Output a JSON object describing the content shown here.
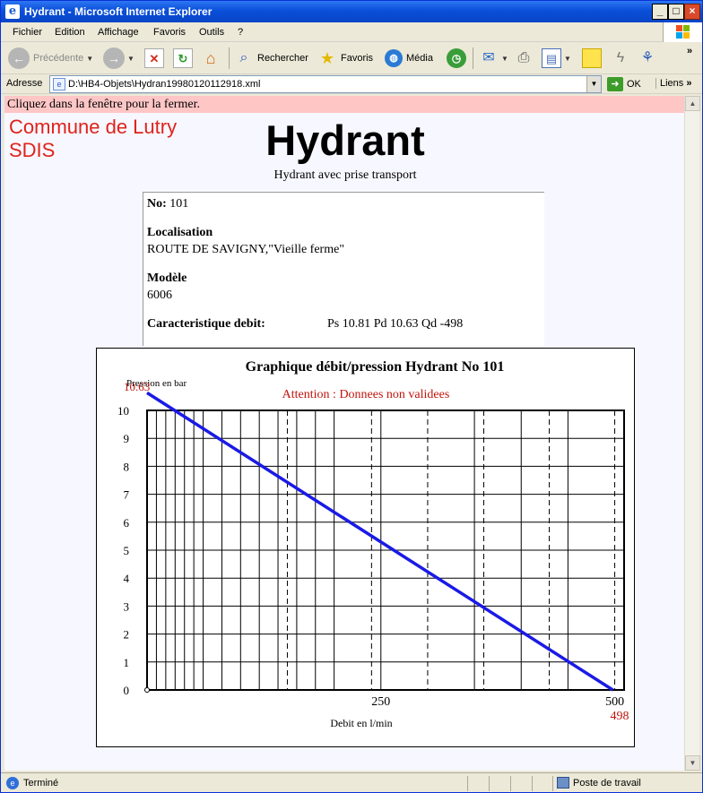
{
  "window": {
    "title": "Hydrant - Microsoft Internet Explorer",
    "controls": [
      "_",
      "□",
      "×"
    ]
  },
  "menu": {
    "items": [
      {
        "label": "Fichier"
      },
      {
        "label": "Edition"
      },
      {
        "label": "Affichage"
      },
      {
        "label": "Favoris"
      },
      {
        "label": "Outils"
      },
      {
        "label": "?"
      }
    ]
  },
  "toolbar": {
    "back_label": "Précédente",
    "search_label": "Rechercher",
    "favorites_label": "Favoris",
    "media_label": "Média",
    "more": "»"
  },
  "address": {
    "label": "Adresse",
    "value": "D:\\HB4-Objets\\Hydran19980120112918.xml",
    "go_label": "OK",
    "links_label": "Liens",
    "links_more": "»"
  },
  "page": {
    "close_hint": "Cliquez dans la fenêtre pour la fermer.",
    "commune_line1": "Commune de Lutry",
    "commune_line2": "SDIS",
    "title": "Hydrant",
    "subtitle": "Hydrant avec prise transport",
    "colors": {
      "commune": "#e0221b",
      "hint_bg": "#ffc6c6",
      "warning": "#c0140c",
      "line": "#1a1ae6"
    }
  },
  "info": {
    "no_label": "No:",
    "no_value": "101",
    "localisation_label": "Localisation",
    "localisation_value": "ROUTE DE SAVIGNY,\"Vieille ferme\"",
    "modele_label": "Modèle",
    "modele_value": "6006",
    "debit_label": "Caracteristique debit:",
    "debit_value": "Ps 10.81 Pd 10.63 Qd -498"
  },
  "chart_data": {
    "type": "line",
    "title": "Graphique débit/pression Hydrant No 101",
    "warning": "Attention : Donnees non validees",
    "ylabel": "Pression en bar",
    "xlabel": "Debit en l/min",
    "y_ticks": [
      0,
      1,
      2,
      3,
      4,
      5,
      6,
      7,
      8,
      9,
      10
    ],
    "x_tick_labels": [
      {
        "value": 250,
        "label": "250"
      },
      {
        "value": 500,
        "label": "500"
      }
    ],
    "xlim": [
      0,
      510
    ],
    "ylim": [
      0,
      10
    ],
    "y_start_label": "10.63",
    "x_end_label": "498",
    "series": [
      {
        "x": [
          0,
          498
        ],
        "y": [
          10.63,
          0
        ]
      }
    ],
    "grid": true
  },
  "status": {
    "text": "Terminé",
    "zone": "Poste de travail"
  }
}
